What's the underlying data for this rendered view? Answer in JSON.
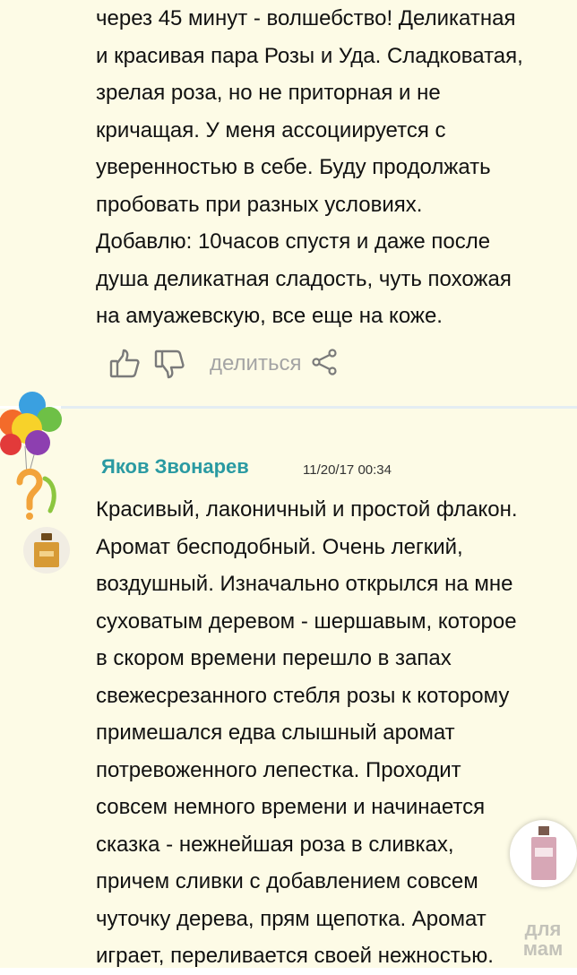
{
  "review1": {
    "text": "через 45 минут - волшебство! Деликатная\nи красивая пара Розы и Уда. Сладковатая,\nзрелая роза, но не приторная и не\nкричащая. У меня ассоциируется с\nуверенностью в себе. Буду продолжать\nпробовать при разных условиях.\nДобавлю: 10часов спустя и даже после\nдуша деликатная сладость, чуть похожая\nна амуажевскую, все еще на коже.",
    "actions": {
      "share_label": "делиться"
    }
  },
  "review2": {
    "author": "Яков Звонарев",
    "date": "11/20/17 00:34",
    "text": "Красивый, лаконичный и простой флакон.\nАромат бесподобный. Очень легкий,\nвоздушный. Изначально открылся на мне\nсуховатым деревом - шершавым, которое\nв скором времени перешло в запах\nсвежесрезанного стебля розы к которому\nпримешался едва слышный аромат\nпотревоженного лепестка. Проходит\nсовсем немного времени и начинается\nсказка - нежнейшая роза в сливках,\nпричем сливки с добавлением совсем\nчуточку дерева, прям щепотка. Аромат\nиграет, переливается своей нежностью."
  },
  "watermark": {
    "line1": "для",
    "line2": "мам"
  },
  "colors": {
    "background": "#fdfbe6",
    "author": "#2a9aa2",
    "divider": "#e4edf2",
    "muted": "#a4a4a4"
  },
  "icons": [
    "thumbs-up-icon",
    "thumbs-down-icon",
    "share-icon",
    "balloons-avatar",
    "perfume-bottle-icon"
  ]
}
